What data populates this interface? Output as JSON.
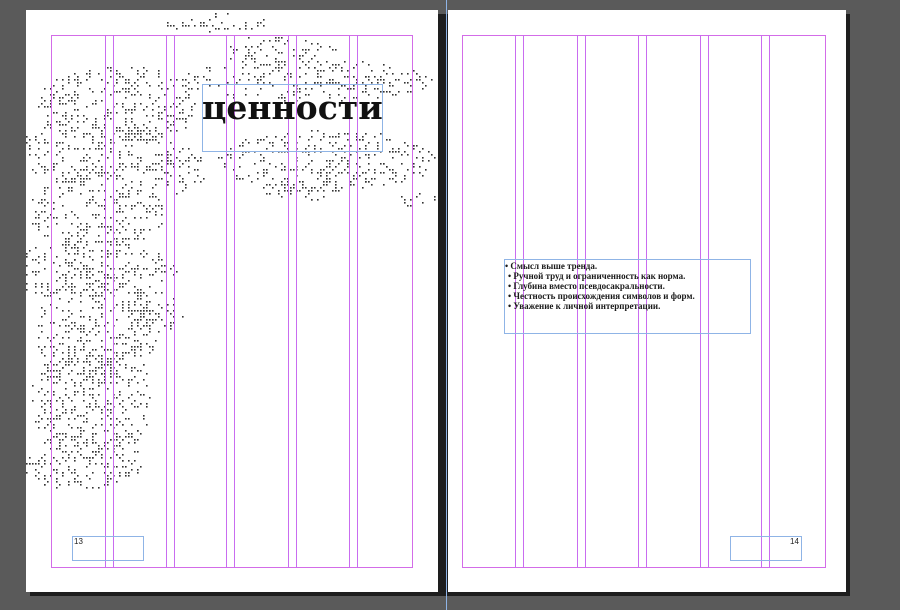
{
  "spread": {
    "left_page": {
      "title": "ценности",
      "page_number": "13",
      "ornament": "dotted-floral-ornament"
    },
    "right_page": {
      "bullets": [
        "• Смысл выше тренда.",
        "• Ручной труд и ограниченность как норма.",
        "• Глубина вместо псевдосакральности.",
        "• Честность происхождения символов и форм.",
        "• Уважение к личной интерпретации."
      ],
      "page_number": "14"
    }
  },
  "colors": {
    "pasteboard": "#5a5a5a",
    "page": "#ffffff",
    "margin_guide": "#d36ce8",
    "column_guide": "#c96cf0",
    "frame_edge": "#8fb4e6"
  }
}
